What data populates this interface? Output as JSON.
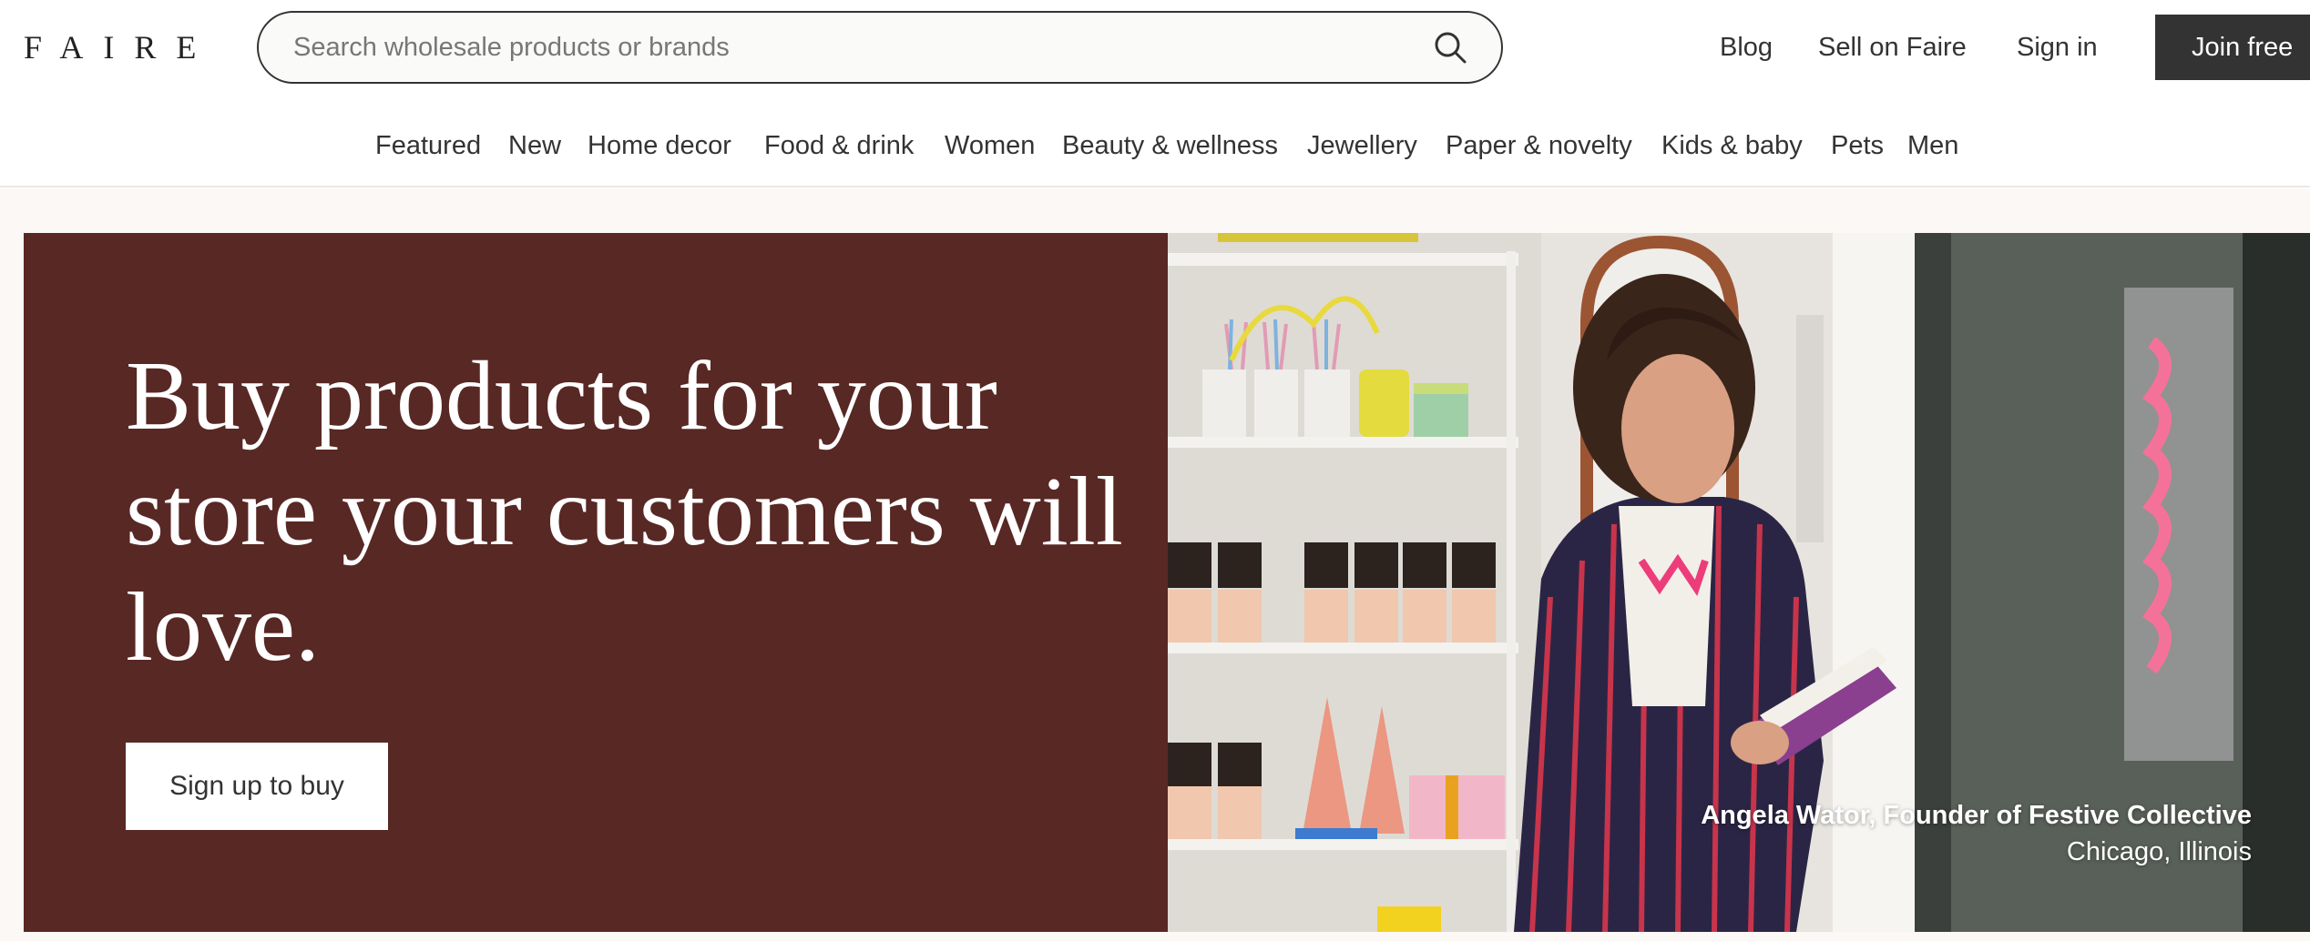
{
  "brand": {
    "logo": "FAIRE"
  },
  "search": {
    "placeholder": "Search wholesale products or brands",
    "icon": "search-icon"
  },
  "top_links": {
    "blog": "Blog",
    "sell": "Sell on Faire",
    "sign_in": "Sign in",
    "join": "Join free"
  },
  "nav": {
    "items": [
      {
        "label": "Featured"
      },
      {
        "label": "New"
      },
      {
        "label": "Home decor"
      },
      {
        "label": "Food & drink"
      },
      {
        "label": "Women"
      },
      {
        "label": "Beauty & wellness"
      },
      {
        "label": "Jewellery"
      },
      {
        "label": "Paper & novelty"
      },
      {
        "label": "Kids & baby"
      },
      {
        "label": "Pets"
      },
      {
        "label": "Men"
      }
    ]
  },
  "hero": {
    "headline": "Buy products for your store your customers will love.",
    "cta": "Sign up to buy",
    "caption_name": "Angela Wator, Founder of Festive Collective",
    "caption_location": "Chicago, Illinois",
    "photo_subject": "store-owner-photo"
  },
  "colors": {
    "hero_panel": "#582824",
    "join_button": "#333333",
    "page_background": "#fbf8f6",
    "text": "#333333"
  }
}
